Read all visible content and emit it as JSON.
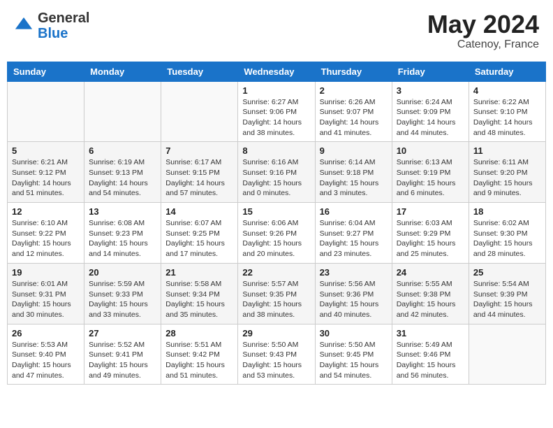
{
  "header": {
    "logo_general": "General",
    "logo_blue": "Blue",
    "month_title": "May 2024",
    "location": "Catenoy, France"
  },
  "days_of_week": [
    "Sunday",
    "Monday",
    "Tuesday",
    "Wednesday",
    "Thursday",
    "Friday",
    "Saturday"
  ],
  "weeks": [
    [
      {
        "day": "",
        "sunrise": "",
        "sunset": "",
        "daylight": ""
      },
      {
        "day": "",
        "sunrise": "",
        "sunset": "",
        "daylight": ""
      },
      {
        "day": "",
        "sunrise": "",
        "sunset": "",
        "daylight": ""
      },
      {
        "day": "1",
        "sunrise": "Sunrise: 6:27 AM",
        "sunset": "Sunset: 9:06 PM",
        "daylight": "Daylight: 14 hours and 38 minutes."
      },
      {
        "day": "2",
        "sunrise": "Sunrise: 6:26 AM",
        "sunset": "Sunset: 9:07 PM",
        "daylight": "Daylight: 14 hours and 41 minutes."
      },
      {
        "day": "3",
        "sunrise": "Sunrise: 6:24 AM",
        "sunset": "Sunset: 9:09 PM",
        "daylight": "Daylight: 14 hours and 44 minutes."
      },
      {
        "day": "4",
        "sunrise": "Sunrise: 6:22 AM",
        "sunset": "Sunset: 9:10 PM",
        "daylight": "Daylight: 14 hours and 48 minutes."
      }
    ],
    [
      {
        "day": "5",
        "sunrise": "Sunrise: 6:21 AM",
        "sunset": "Sunset: 9:12 PM",
        "daylight": "Daylight: 14 hours and 51 minutes."
      },
      {
        "day": "6",
        "sunrise": "Sunrise: 6:19 AM",
        "sunset": "Sunset: 9:13 PM",
        "daylight": "Daylight: 14 hours and 54 minutes."
      },
      {
        "day": "7",
        "sunrise": "Sunrise: 6:17 AM",
        "sunset": "Sunset: 9:15 PM",
        "daylight": "Daylight: 14 hours and 57 minutes."
      },
      {
        "day": "8",
        "sunrise": "Sunrise: 6:16 AM",
        "sunset": "Sunset: 9:16 PM",
        "daylight": "Daylight: 15 hours and 0 minutes."
      },
      {
        "day": "9",
        "sunrise": "Sunrise: 6:14 AM",
        "sunset": "Sunset: 9:18 PM",
        "daylight": "Daylight: 15 hours and 3 minutes."
      },
      {
        "day": "10",
        "sunrise": "Sunrise: 6:13 AM",
        "sunset": "Sunset: 9:19 PM",
        "daylight": "Daylight: 15 hours and 6 minutes."
      },
      {
        "day": "11",
        "sunrise": "Sunrise: 6:11 AM",
        "sunset": "Sunset: 9:20 PM",
        "daylight": "Daylight: 15 hours and 9 minutes."
      }
    ],
    [
      {
        "day": "12",
        "sunrise": "Sunrise: 6:10 AM",
        "sunset": "Sunset: 9:22 PM",
        "daylight": "Daylight: 15 hours and 12 minutes."
      },
      {
        "day": "13",
        "sunrise": "Sunrise: 6:08 AM",
        "sunset": "Sunset: 9:23 PM",
        "daylight": "Daylight: 15 hours and 14 minutes."
      },
      {
        "day": "14",
        "sunrise": "Sunrise: 6:07 AM",
        "sunset": "Sunset: 9:25 PM",
        "daylight": "Daylight: 15 hours and 17 minutes."
      },
      {
        "day": "15",
        "sunrise": "Sunrise: 6:06 AM",
        "sunset": "Sunset: 9:26 PM",
        "daylight": "Daylight: 15 hours and 20 minutes."
      },
      {
        "day": "16",
        "sunrise": "Sunrise: 6:04 AM",
        "sunset": "Sunset: 9:27 PM",
        "daylight": "Daylight: 15 hours and 23 minutes."
      },
      {
        "day": "17",
        "sunrise": "Sunrise: 6:03 AM",
        "sunset": "Sunset: 9:29 PM",
        "daylight": "Daylight: 15 hours and 25 minutes."
      },
      {
        "day": "18",
        "sunrise": "Sunrise: 6:02 AM",
        "sunset": "Sunset: 9:30 PM",
        "daylight": "Daylight: 15 hours and 28 minutes."
      }
    ],
    [
      {
        "day": "19",
        "sunrise": "Sunrise: 6:01 AM",
        "sunset": "Sunset: 9:31 PM",
        "daylight": "Daylight: 15 hours and 30 minutes."
      },
      {
        "day": "20",
        "sunrise": "Sunrise: 5:59 AM",
        "sunset": "Sunset: 9:33 PM",
        "daylight": "Daylight: 15 hours and 33 minutes."
      },
      {
        "day": "21",
        "sunrise": "Sunrise: 5:58 AM",
        "sunset": "Sunset: 9:34 PM",
        "daylight": "Daylight: 15 hours and 35 minutes."
      },
      {
        "day": "22",
        "sunrise": "Sunrise: 5:57 AM",
        "sunset": "Sunset: 9:35 PM",
        "daylight": "Daylight: 15 hours and 38 minutes."
      },
      {
        "day": "23",
        "sunrise": "Sunrise: 5:56 AM",
        "sunset": "Sunset: 9:36 PM",
        "daylight": "Daylight: 15 hours and 40 minutes."
      },
      {
        "day": "24",
        "sunrise": "Sunrise: 5:55 AM",
        "sunset": "Sunset: 9:38 PM",
        "daylight": "Daylight: 15 hours and 42 minutes."
      },
      {
        "day": "25",
        "sunrise": "Sunrise: 5:54 AM",
        "sunset": "Sunset: 9:39 PM",
        "daylight": "Daylight: 15 hours and 44 minutes."
      }
    ],
    [
      {
        "day": "26",
        "sunrise": "Sunrise: 5:53 AM",
        "sunset": "Sunset: 9:40 PM",
        "daylight": "Daylight: 15 hours and 47 minutes."
      },
      {
        "day": "27",
        "sunrise": "Sunrise: 5:52 AM",
        "sunset": "Sunset: 9:41 PM",
        "daylight": "Daylight: 15 hours and 49 minutes."
      },
      {
        "day": "28",
        "sunrise": "Sunrise: 5:51 AM",
        "sunset": "Sunset: 9:42 PM",
        "daylight": "Daylight: 15 hours and 51 minutes."
      },
      {
        "day": "29",
        "sunrise": "Sunrise: 5:50 AM",
        "sunset": "Sunset: 9:43 PM",
        "daylight": "Daylight: 15 hours and 53 minutes."
      },
      {
        "day": "30",
        "sunrise": "Sunrise: 5:50 AM",
        "sunset": "Sunset: 9:45 PM",
        "daylight": "Daylight: 15 hours and 54 minutes."
      },
      {
        "day": "31",
        "sunrise": "Sunrise: 5:49 AM",
        "sunset": "Sunset: 9:46 PM",
        "daylight": "Daylight: 15 hours and 56 minutes."
      },
      {
        "day": "",
        "sunrise": "",
        "sunset": "",
        "daylight": ""
      }
    ]
  ]
}
